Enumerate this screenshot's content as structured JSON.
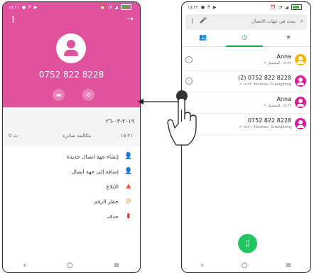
{
  "left": {
    "status": {
      "time": "١٥:٢١"
    },
    "header": {
      "phone_number": "0752 822 8228",
      "color": "#e0529e"
    },
    "call": {
      "date": "٢٠١٩-٠٣-٢٦",
      "type": "مكالمة صادرة",
      "time": "١٥:٢١",
      "duration": "0 ث"
    },
    "actions": [
      {
        "label": "إنشاء جهة اتصال جديدة",
        "icon": "add-person-icon"
      },
      {
        "label": "إضافة إلى جهة اتصال",
        "icon": "person-icon"
      },
      {
        "label": "الإبلاغ",
        "icon": "warning-icon"
      },
      {
        "label": "حظر الرقم",
        "icon": "block-icon"
      },
      {
        "label": "حذف",
        "icon": "trash-icon"
      }
    ]
  },
  "right": {
    "status": {
      "time": "١٥:٢٢"
    },
    "search": {
      "placeholder": "بحث في جهات الاتصال"
    },
    "calls": [
      {
        "name": "Anna",
        "detail": "١٥:٢٢ ,المحمول",
        "avatar_color": "#f5b400"
      },
      {
        "name": "(2) 0752 822 8228",
        "detail": "١٥:٢٢ ,Huizhou, Guangdong",
        "avatar_color": "#d81b9a"
      },
      {
        "name": "Anna",
        "detail": "١٥:٢٢ ,المحمول",
        "avatar_color": "#f5b400"
      },
      {
        "name": "0752 822 8228",
        "detail": "١٥:٢١ ,Huizhou, Guangdong",
        "avatar_color": "#d81b9a"
      }
    ],
    "accent": "#16a34a"
  }
}
